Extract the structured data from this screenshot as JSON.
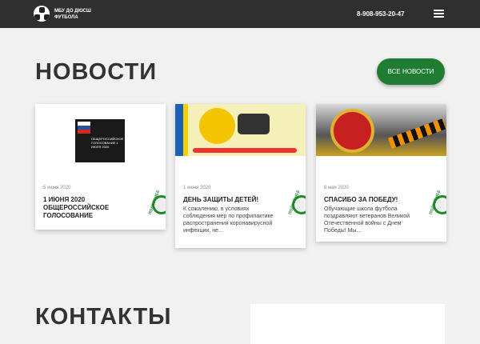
{
  "header": {
    "org_line1": "МБУ ДО ДЮСШ",
    "org_line2": "ФУТБОЛА",
    "phone": "8-908-953-20-47"
  },
  "news": {
    "title": "НОВОСТИ",
    "all_button": "ВСЕ НОВОСТИ",
    "items": [
      {
        "date": "5 июня 2020",
        "title": "1 ИЮНЯ 2020 ОБЩЕРОССИЙСКОЕ ГОЛОСОВАНИЕ",
        "text": "",
        "image_caption": "ОБЩЕРОССИЙСКОЕ ГОЛОСОВАНИЕ 1 ИЮЛЯ 2020",
        "more": "ПОДРОБНЕЕ"
      },
      {
        "date": "1 июня 2020",
        "title": "ДЕНЬ ЗАЩИТЫ ДЕТЕЙ!",
        "text": "К сожалению, в условиях соблюдения мер по профилактике распространения коронавирусной инфекции, не...",
        "more": "ПОДРОБНЕЕ"
      },
      {
        "date": "8 мая 2020",
        "title": "СПАСИБО ЗА ПОБЕДУ!",
        "text": "Обучающие школа футбола поздравляют ветеранов Великой Отечественной войны с Днем Победы! Мы...",
        "more": "ПОДРОБНЕЕ"
      }
    ]
  },
  "contacts": {
    "title": "КОНТАКТЫ"
  }
}
